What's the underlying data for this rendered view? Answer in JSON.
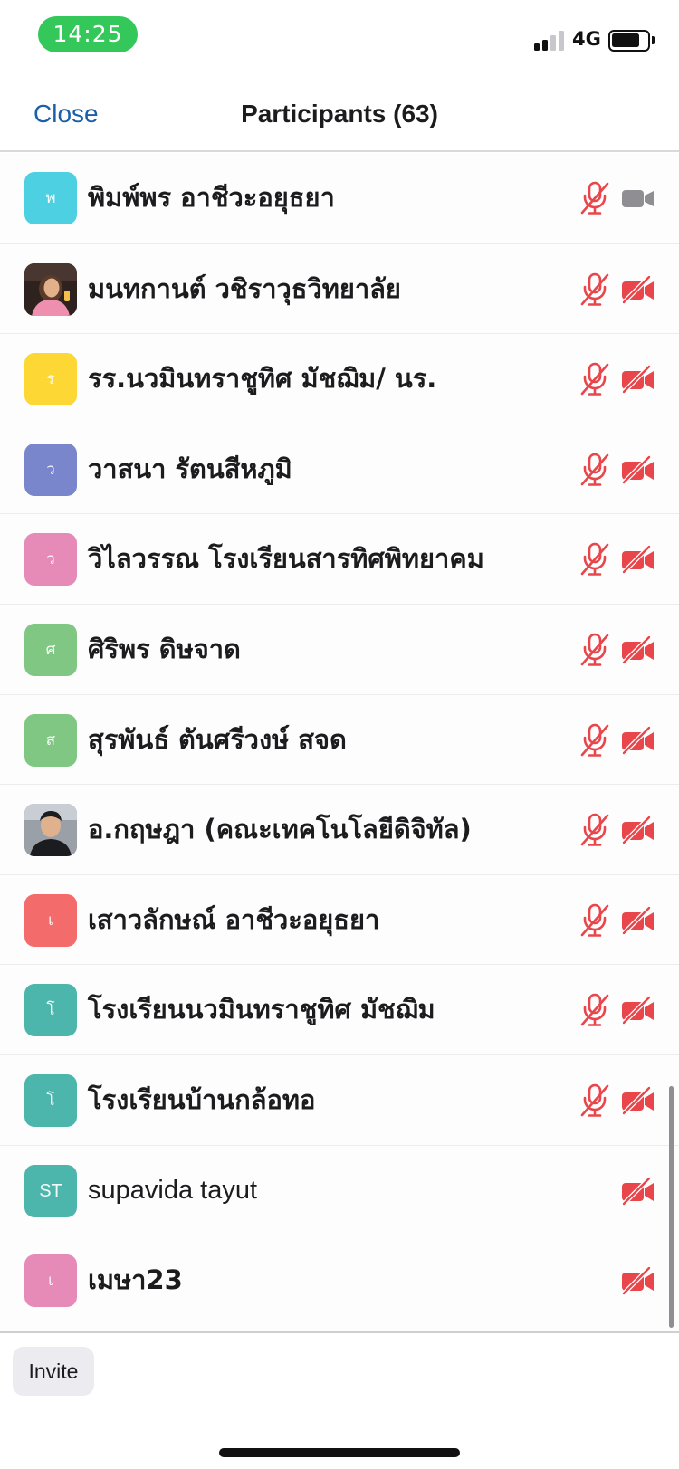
{
  "status_bar": {
    "time": "14:25",
    "network": "4G",
    "battery_level": 0.8
  },
  "nav": {
    "close_label": "Close",
    "title": "Participants (63)"
  },
  "colors": {
    "time_pill": "#34c759",
    "close_link": "#1a5fa8",
    "muted_icon": "#e8464b",
    "video_on_icon": "#8e8e93"
  },
  "participants": [
    {
      "name": "พิมพ์พร อาชีวะอยุธยา",
      "avatar_text": "พ",
      "avatar_color": "#4dd0e1",
      "avatar_type": "initial",
      "mic": "muted",
      "video": "on"
    },
    {
      "name": "มนทกานต์ วชิราวุธวิทยาลัย",
      "avatar_text": "",
      "avatar_color": "#3a2a25",
      "avatar_type": "photo-woman",
      "mic": "muted",
      "video": "off"
    },
    {
      "name": "รร.นวมินทราชูทิศ มัชฌิม/ นร.",
      "avatar_text": "ร",
      "avatar_color": "#fdd835",
      "avatar_type": "initial",
      "mic": "muted",
      "video": "off"
    },
    {
      "name": "วาสนา รัตนสีหภูมิ",
      "avatar_text": "ว",
      "avatar_color": "#7986cb",
      "avatar_type": "initial",
      "mic": "muted",
      "video": "off"
    },
    {
      "name": "วิไลวรรณ โรงเรียนสารทิศพิทยาคม",
      "avatar_text": "ว",
      "avatar_color": "#e68ab8",
      "avatar_type": "initial",
      "mic": "muted",
      "video": "off"
    },
    {
      "name": "ศิริพร ดิษจาด",
      "avatar_text": "ศ",
      "avatar_color": "#81c784",
      "avatar_type": "initial",
      "mic": "muted",
      "video": "off"
    },
    {
      "name": "สุรพันธ์ ตันศรีวงษ์  สจด",
      "avatar_text": "ส",
      "avatar_color": "#81c784",
      "avatar_type": "initial",
      "mic": "muted",
      "video": "off"
    },
    {
      "name": "อ.กฤษฎา (คณะเทคโนโลยีดิจิทัล)",
      "avatar_text": "",
      "avatar_color": "#6d7078",
      "avatar_type": "photo-man",
      "mic": "muted",
      "video": "off"
    },
    {
      "name": "เสาวลักษณ์  อาชีวะอยุธยา",
      "avatar_text": "เ",
      "avatar_color": "#f46b6b",
      "avatar_type": "initial",
      "mic": "muted",
      "video": "off"
    },
    {
      "name": "โรงเรียนนวมินทราชูทิศ มัชฌิม",
      "avatar_text": "โ",
      "avatar_color": "#4db6ac",
      "avatar_type": "initial",
      "mic": "muted",
      "video": "off"
    },
    {
      "name": "โรงเรียนบ้านกล้อทอ",
      "avatar_text": "โ",
      "avatar_color": "#4db6ac",
      "avatar_type": "initial",
      "mic": "muted",
      "video": "off"
    },
    {
      "name": "supavida tayut",
      "avatar_text": "ST",
      "avatar_color": "#4db6ac",
      "avatar_type": "initial",
      "mic": "none",
      "video": "off"
    },
    {
      "name": "เมษา23",
      "avatar_text": "เ",
      "avatar_color": "#e68ab8",
      "avatar_type": "initial",
      "mic": "none",
      "video": "off"
    }
  ],
  "footer": {
    "invite_label": "Invite"
  }
}
